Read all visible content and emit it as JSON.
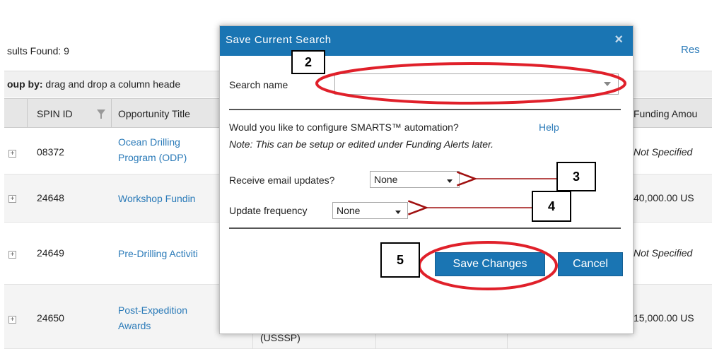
{
  "background": {
    "results_found": "sults Found: 9",
    "reset_link": "Res",
    "group_by_bold": "oup by:",
    "group_by_text": " drag and drop a column heade",
    "columns": {
      "spin_id": "SPIN ID",
      "opportunity_title": "Opportunity Title",
      "funding_amount": "Funding Amou"
    },
    "rows": [
      {
        "spin": "08372",
        "title": [
          "Ocean Drilling",
          "Program (ODP)"
        ],
        "amount": "Not Specified",
        "amount_italic": true
      },
      {
        "spin": "24648",
        "title": [
          "Workshop Fundin"
        ],
        "amount": "40,000.00 US",
        "amount_italic": false
      },
      {
        "spin": "24649",
        "title": [
          "Pre-Drilling Activiti"
        ],
        "amount": "Not Specified",
        "amount_italic": true
      },
      {
        "spin": "24650",
        "title": [
          "Post-Expedition",
          "Awards"
        ],
        "amount": "15,000.00 US",
        "amount_italic": false
      }
    ],
    "partial_cell": "(USSSP)"
  },
  "modal": {
    "title": "Save Current Search",
    "close_glyph": "×",
    "search_name_label": "Search name",
    "search_name_value": "",
    "question": "Would you like to configure SMARTS™ automation?",
    "help_link": "Help",
    "note": "Note: This can be setup or edited under Funding Alerts later.",
    "email_label": "Receive email updates?",
    "email_value": "None",
    "frequency_label": "Update frequency",
    "frequency_value": "None",
    "save_button": "Save Changes",
    "cancel_button": "Cancel"
  },
  "annotations": {
    "step_2": "2",
    "step_3": "3",
    "step_4": "4",
    "step_5": "5"
  },
  "colors": {
    "accent": "#1a75b3",
    "link": "#2a7ab8",
    "annotation_red": "#e0202a",
    "arrow_red": "#a01010"
  }
}
